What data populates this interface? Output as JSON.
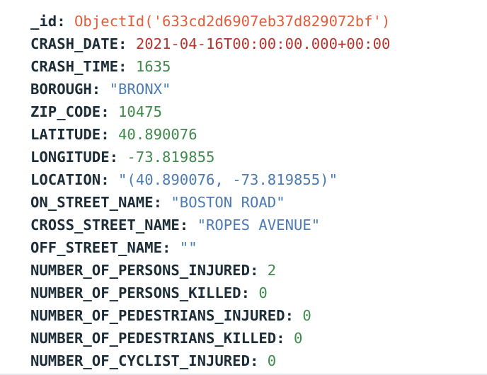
{
  "document": {
    "fields": [
      {
        "key": "_id",
        "value": "ObjectId('633cd2d6907eb37d829072bf')",
        "type": "objectid"
      },
      {
        "key": "CRASH_DATE",
        "value": "2021-04-16T00:00:00.000+00:00",
        "type": "date"
      },
      {
        "key": "CRASH_TIME",
        "value": "1635",
        "type": "number"
      },
      {
        "key": "BOROUGH",
        "value": "\"BRONX\"",
        "type": "string"
      },
      {
        "key": "ZIP_CODE",
        "value": "10475",
        "type": "number"
      },
      {
        "key": "LATITUDE",
        "value": "40.890076",
        "type": "number"
      },
      {
        "key": "LONGITUDE",
        "value": "-73.819855",
        "type": "number"
      },
      {
        "key": "LOCATION",
        "value": "\"(40.890076, -73.819855)\"",
        "type": "string"
      },
      {
        "key": "ON_STREET_NAME",
        "value": "\"BOSTON ROAD\"",
        "type": "string"
      },
      {
        "key": "CROSS_STREET_NAME",
        "value": "\"ROPES AVENUE\"",
        "type": "string"
      },
      {
        "key": "OFF_STREET_NAME",
        "value": "\"\"",
        "type": "string"
      },
      {
        "key": "NUMBER_OF_PERSONS_INJURED",
        "value": "2",
        "type": "number"
      },
      {
        "key": "NUMBER_OF_PERSONS_KILLED",
        "value": "0",
        "type": "number"
      },
      {
        "key": "NUMBER_OF_PEDESTRIANS_INJURED",
        "value": "0",
        "type": "number"
      },
      {
        "key": "NUMBER_OF_PEDESTRIANS_KILLED",
        "value": "0",
        "type": "number"
      },
      {
        "key": "NUMBER_OF_CYCLIST_INJURED",
        "value": "0",
        "type": "number"
      }
    ],
    "separator": ": "
  },
  "colors": {
    "key": "#1c2d38",
    "objectid": "#e45d3a",
    "date": "#b8342c",
    "number": "#3f8a4a",
    "string": "#4b7bb2"
  }
}
